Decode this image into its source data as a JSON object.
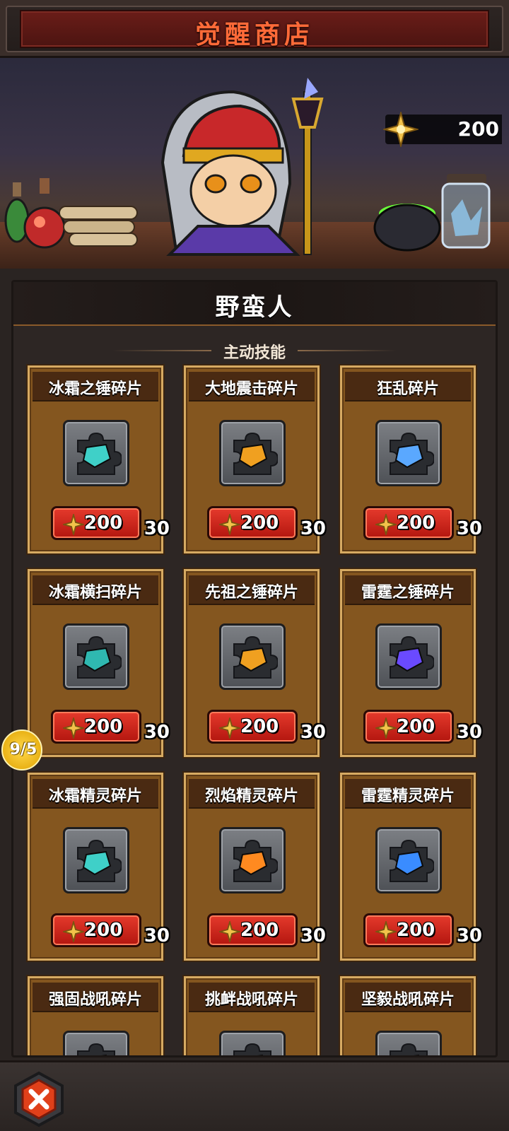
{
  "header": {
    "title": "觉醒商店"
  },
  "currency": {
    "amount": "200",
    "icon": "gold-cross-icon"
  },
  "panel": {
    "hero_name": "野蛮人",
    "section_title": "主动技能"
  },
  "items": [
    {
      "name": "冰霜之锤碎片",
      "qty": "30",
      "price": "200",
      "color": "#3fd0c8"
    },
    {
      "name": "大地震击碎片",
      "qty": "30",
      "price": "200",
      "color": "#f0a020"
    },
    {
      "name": "狂乱碎片",
      "qty": "30",
      "price": "200",
      "color": "#5aa8ff"
    },
    {
      "name": "冰霜横扫碎片",
      "qty": "30",
      "price": "200",
      "color": "#2fb8b0"
    },
    {
      "name": "先祖之锤碎片",
      "qty": "30",
      "price": "200",
      "color": "#f0a020"
    },
    {
      "name": "雷霆之锤碎片",
      "qty": "30",
      "price": "200",
      "color": "#6a4aff"
    },
    {
      "name": "冰霜精灵碎片",
      "qty": "30",
      "price": "200",
      "color": "#3fd0c8"
    },
    {
      "name": "烈焰精灵碎片",
      "qty": "30",
      "price": "200",
      "color": "#ff8a20"
    },
    {
      "name": "雷霆精灵碎片",
      "qty": "30",
      "price": "200",
      "color": "#3a8cff"
    },
    {
      "name": "强固战吼碎片",
      "qty": "",
      "price": "",
      "color": "#888888"
    },
    {
      "name": "挑衅战吼碎片",
      "qty": "",
      "price": "",
      "color": "#888888"
    },
    {
      "name": "坚毅战吼碎片",
      "qty": "",
      "price": "",
      "color": "#888888"
    }
  ],
  "side_badge": {
    "text": "9/5"
  }
}
